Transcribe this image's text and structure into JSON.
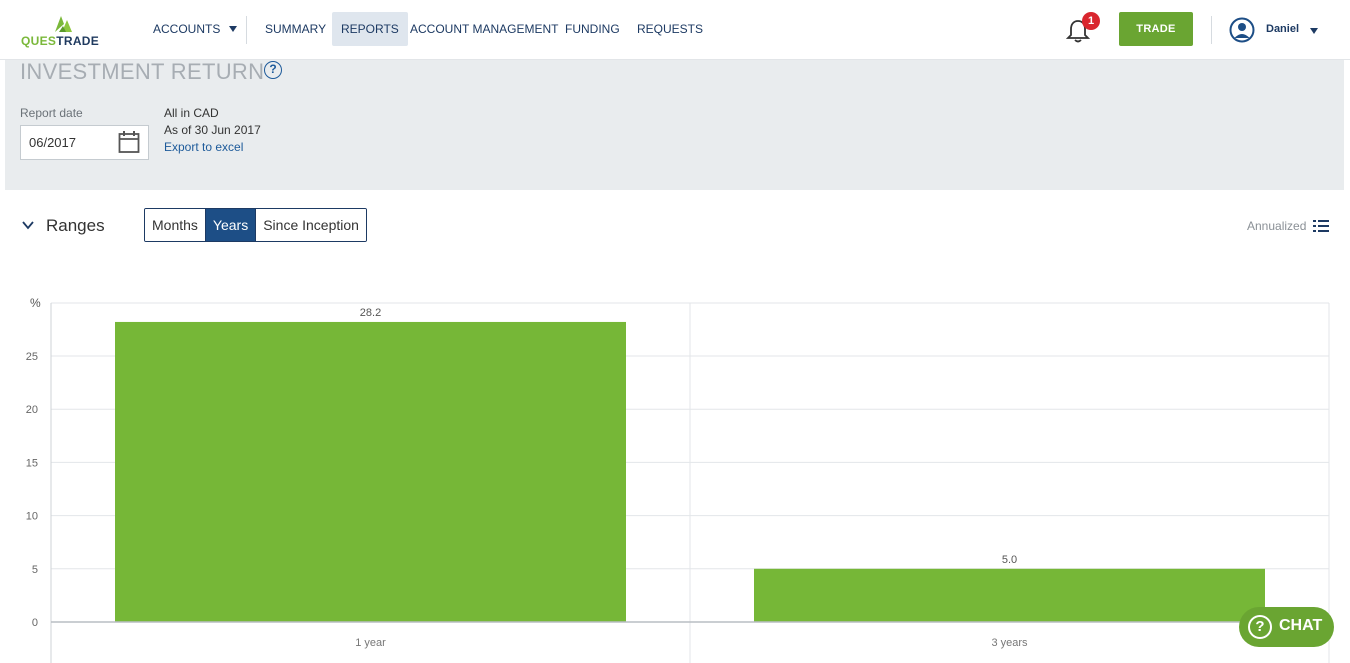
{
  "logo": {
    "part1": "QUES",
    "part2": "TRADE"
  },
  "nav": {
    "accounts": "ACCOUNTS",
    "summary": "SUMMARY",
    "reports": "REPORTS",
    "account_management": "ACCOUNT MANAGEMENT",
    "funding": "FUNDING",
    "requests": "REQUESTS"
  },
  "notifications": {
    "count": "1"
  },
  "trade_label": "TRADE",
  "user": {
    "name": "Daniel"
  },
  "page": {
    "title": "INVESTMENT RETURN",
    "help": "?",
    "report_date_label": "Report date",
    "report_date_value": "06/2017",
    "currency_note": "All in CAD",
    "as_of": "As of 30 Jun 2017",
    "export": "Export to excel"
  },
  "ranges": {
    "label": "Ranges",
    "options": [
      "Months",
      "Years",
      "Since Inception"
    ],
    "selected": "Years",
    "annualized": "Annualized"
  },
  "chat_label": "CHAT",
  "colors": {
    "bar": "#76b737",
    "brand_navy": "#1d3a63",
    "trade_green": "#6aa532",
    "badge_red": "#d9262e"
  },
  "chart_data": {
    "type": "bar",
    "categories": [
      "1 year",
      "3 years"
    ],
    "values": [
      28.2,
      5.0
    ],
    "value_labels": [
      "28.2",
      "5.0"
    ],
    "ylabel": "%",
    "yticks": [
      0,
      5,
      10,
      15,
      20,
      25
    ],
    "ylim": [
      0,
      30
    ],
    "grid": true
  }
}
